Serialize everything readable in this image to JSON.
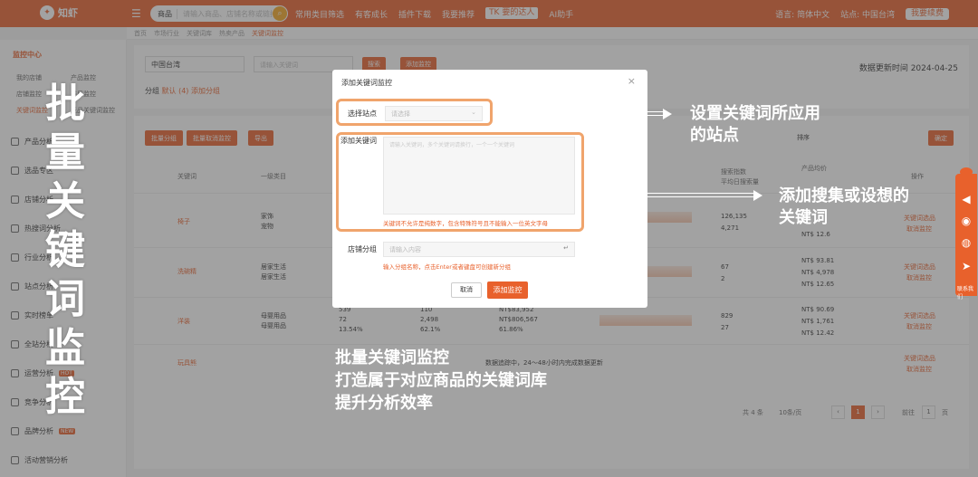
{
  "topbar": {
    "logo": "知虾",
    "search_category": "商品",
    "search_placeholder": "请输入商品、店铺名称或链接",
    "nav": [
      "常用类目筛选",
      "有客成长",
      "插件下载",
      "我要推荐",
      "TK 要的达人",
      "AI助手"
    ],
    "language": "语言: 简体中文",
    "site": "站点: 中国台湾",
    "renew": "我要续费"
  },
  "tabs": [
    "首页",
    "市场行业",
    "关键词库",
    "热卖产品",
    "关键词监控"
  ],
  "sidebar": {
    "section": "监控中心",
    "sub_items": [
      "我的店铺",
      "产品监控",
      "店铺监控",
      "类目监控",
      "关键词监控",
      "竞品关键词监控"
    ],
    "hot_badge": "HOT",
    "items": [
      "产品分析",
      "选品专区",
      "店铺分析",
      "热搜词分析",
      "行业分析",
      "站点分析",
      "实时榜单",
      "全站分析",
      "运营分析",
      "竞争分析",
      "品牌分析",
      "活动营销分析"
    ],
    "new_badge": "NEW"
  },
  "main": {
    "country_select": "中国台湾",
    "keyword_placeholder": "请输入关键词",
    "search_btn": "搜索",
    "add_monitor_btn": "添加监控",
    "updated": "数据更新时间 2024-04-25",
    "group_label": "分组",
    "group_default": "默认 (4)",
    "add_group": "添加分组",
    "toolbar": [
      "批量分组",
      "批量取消监控",
      "导出"
    ],
    "sort_label": "排序",
    "confirm_btn": "确定",
    "headers": [
      "关键词",
      "一级类目",
      "搜索指数",
      "平均日搜索量",
      "产品均价",
      "操作"
    ],
    "rows": [
      {
        "kw": "椅子",
        "cat": [
          "家饰",
          "宠物"
        ],
        "a": "",
        "b": "",
        "c": "",
        "search": "126,135",
        "avg": "4,271",
        "prices": [
          "NT$ 12.6"
        ],
        "ops": [
          "关键词选品",
          "取消监控"
        ]
      },
      {
        "kw": "洗碗精",
        "cat": [
          "居家生活",
          "居家生活"
        ],
        "a": "",
        "b": "",
        "c": "",
        "search": "67",
        "avg": "2",
        "prices": [
          "NT$ 93.81",
          "NT$ 4,978",
          "NT$ 12.65"
        ],
        "ops": [
          "关键词选品",
          "取消监控"
        ]
      },
      {
        "kw": "洋装",
        "cat": [
          "母婴用品",
          "母婴用品"
        ],
        "a": [
          "539",
          "72",
          "13.54%"
        ],
        "b": [
          "110",
          "2,498",
          "62.1%"
        ],
        "c": [
          "NT$83,952",
          "NT$806,567",
          "61.86%"
        ],
        "search": "829",
        "avg": "27",
        "prices": [
          "NT$ 90.69",
          "NT$ 1,761",
          "NT$ 12.42"
        ],
        "ops": [
          "关键词选品",
          "取消监控"
        ]
      },
      {
        "kw": "玩具熊",
        "cat": [],
        "note": "数据追踪中，24～48小时内完成数据更新",
        "ops": [
          "关键词选品",
          "取消监控"
        ]
      }
    ],
    "pagination": {
      "total": "共 4 条",
      "per_page": "10条/页",
      "current": "1",
      "goto_label": "前往",
      "goto_value": "1",
      "page_unit": "页"
    }
  },
  "modal": {
    "title": "添加关键词监控",
    "site_label": "选择站点",
    "site_placeholder": "请选择",
    "kw_label": "添加关键词",
    "kw_placeholder": "请输入关键词，多个关键词请换行，一个一个关键词",
    "kw_hint": "关键词不允许是纯数字，包含特殊符号且不能输入一位英文字母",
    "group_label": "店铺分组",
    "group_placeholder": "请输入内容",
    "group_hint": "输入分组名称，点击Enter或者键盘可创建新分组",
    "cancel": "取消",
    "confirm": "添加监控"
  },
  "annotations": {
    "vertical": [
      "批",
      "量",
      "关",
      "键",
      "词",
      "监",
      "控"
    ],
    "callout1": [
      "设置关键词所应用",
      "的站点"
    ],
    "callout2": [
      "添加搜集或设想的",
      "关键词"
    ],
    "bottom": [
      "批量关键词监控",
      "打造属于对应商品的关键词库",
      "提升分析效率"
    ]
  },
  "floatbar": {
    "label": "联系我们"
  }
}
